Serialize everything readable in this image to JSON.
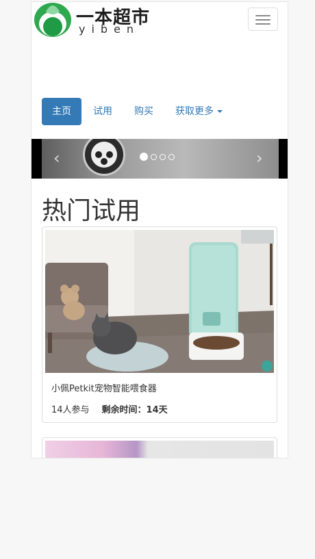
{
  "brand": {
    "name_cn": "一本超市",
    "name_en": "yiben",
    "logo_color": "#27a84a"
  },
  "nav": {
    "items": [
      {
        "label": "主页",
        "active": true
      },
      {
        "label": "试用",
        "active": false
      },
      {
        "label": "购买",
        "active": false
      },
      {
        "label": "获取更多",
        "active": false,
        "dropdown": true
      }
    ]
  },
  "carousel": {
    "prev": "‹",
    "next": "›",
    "slide_count": 4,
    "active_index": 0
  },
  "section": {
    "title": "热门试用"
  },
  "products": [
    {
      "title": "小佩Petkit宠物智能喂食器",
      "participants": "14人参与",
      "remaining": "剩余时间：14天"
    },
    {
      "title": "",
      "participants": "",
      "remaining": ""
    }
  ],
  "colors": {
    "accent": "#337ab7",
    "nav_active_bg": "#337ab7",
    "page_bg": "#f7f7f7"
  }
}
